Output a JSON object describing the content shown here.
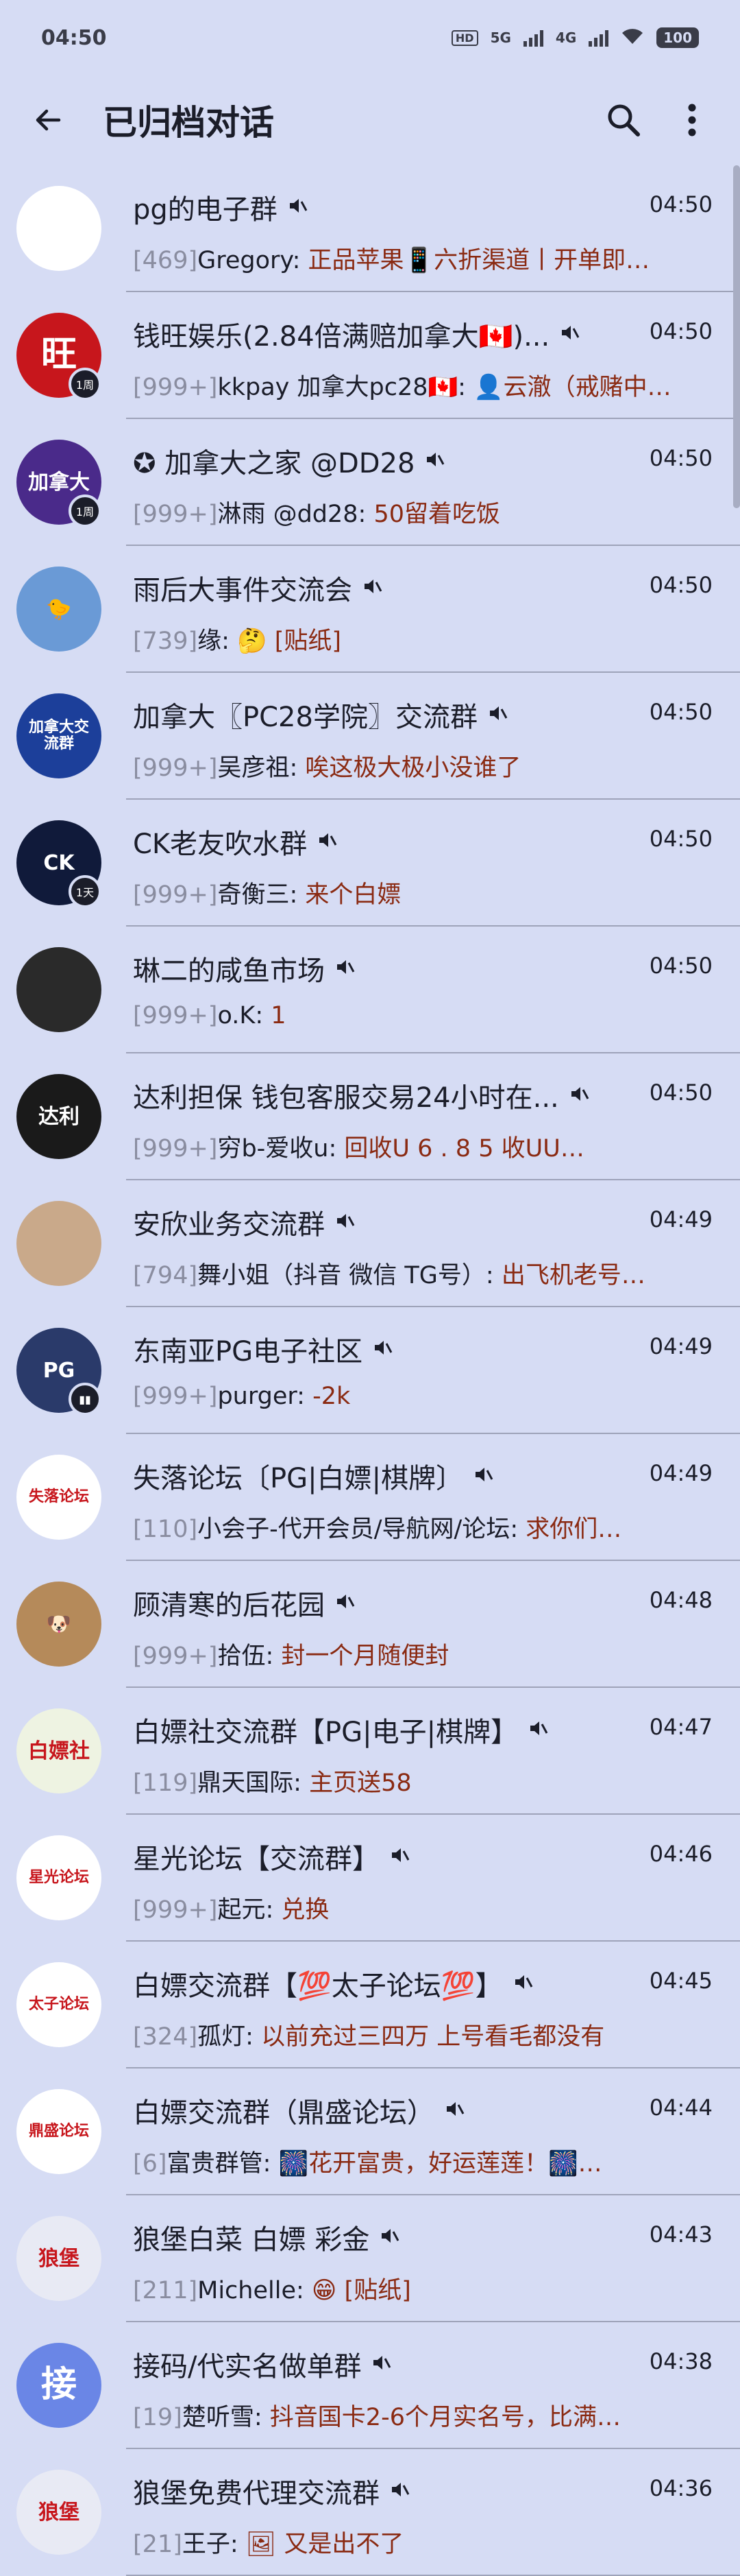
{
  "status_bar": {
    "time": "04:50",
    "network1": "5G",
    "network2": "4G",
    "battery": "100",
    "hd": "HD"
  },
  "app_bar": {
    "title": "已归档对话",
    "back_icon": "arrow-back-icon",
    "search_icon": "search-icon",
    "more_icon": "more-vert-icon"
  },
  "chats": [
    {
      "name": "pg的电子群",
      "time": "04:50",
      "count": "[469]",
      "sender": "Gregory:",
      "text": "正品苹果📱六折渠道丨开单即…",
      "avatar_text": "",
      "avatar_color": "#ffffff",
      "badge": ""
    },
    {
      "name": "钱旺娱乐(2.84倍满赔加拿大🇨🇦)...",
      "time": "04:50",
      "count": "[999+]",
      "sender": "kkpay 加拿大pc28🇨🇦:",
      "text": "👤云澈（戒赌中…",
      "avatar_text": "旺",
      "avatar_color": "#c7161c",
      "badge": "1周"
    },
    {
      "name": "✪ 加拿大之家 @DD28",
      "time": "04:50",
      "count": "[999+]",
      "sender": "淋雨 @dd28:",
      "text": "50留着吃饭",
      "avatar_text": "加拿大",
      "avatar_color": "#4a2a8a",
      "badge": "1周"
    },
    {
      "name": "雨后大事件交流会",
      "time": "04:50",
      "count": "[739]",
      "sender": "缘:",
      "text": "🤔 [贴纸]",
      "avatar_text": "🐤",
      "avatar_color": "#6a9ad6",
      "badge": ""
    },
    {
      "name": "加拿大〖PC28学院〗交流群",
      "time": "04:50",
      "count": "[999+]",
      "sender": "吴彦祖:",
      "text": "唉这极大极小没谁了",
      "avatar_text": "加拿大交流群",
      "avatar_color": "#1c3f9a",
      "badge": ""
    },
    {
      "name": "CK老友吹水群",
      "time": "04:50",
      "count": "[999+]",
      "sender": "奇衡三:",
      "text": "来个白嫖",
      "avatar_text": "CK",
      "avatar_color": "#101a3a",
      "badge": "1天"
    },
    {
      "name": "琳二的咸鱼市场",
      "time": "04:50",
      "count": "[999+]",
      "sender": "o.K:",
      "text": "1",
      "avatar_text": "",
      "avatar_color": "#2a2a2a",
      "badge": ""
    },
    {
      "name": "达利担保 钱包客服交易24小时在...",
      "time": "04:50",
      "count": "[999+]",
      "sender": "穷b-爱收u:",
      "text": "回收U 6 . 8 5 收UU…",
      "avatar_text": "达利",
      "avatar_color": "#1a1a1a",
      "badge": ""
    },
    {
      "name": "安欣业务交流群",
      "time": "04:49",
      "count": "[794]",
      "sender": "舞小姐（抖音 微信 TG号）:",
      "text": "出飞机老号…",
      "avatar_text": "",
      "avatar_color": "#c9a98a",
      "badge": ""
    },
    {
      "name": "东南亚PG电子社区",
      "time": "04:49",
      "count": "[999+]",
      "sender": "purger:",
      "text": "-2k",
      "avatar_text": "PG",
      "avatar_color": "#2a3a6a",
      "badge": "▮▮"
    },
    {
      "name": "失落论坛〔PG|白嫖|棋牌〕",
      "time": "04:49",
      "count": "[110]",
      "sender": "小会子-代开会员/导航网/论坛:",
      "text": "求你们…",
      "avatar_text": "失落论坛",
      "avatar_color": "#ffffff",
      "badge": ""
    },
    {
      "name": "顾清寒的后花园",
      "time": "04:48",
      "count": "[999+]",
      "sender": "拾伍:",
      "text": "封一个月随便封",
      "avatar_text": "🐶",
      "avatar_color": "#b58a5a",
      "badge": ""
    },
    {
      "name": "白嫖社交流群【PG|电子|棋牌】",
      "time": "04:47",
      "count": "[119]",
      "sender": "鼎天国际:",
      "text": "主页送58",
      "avatar_text": "白嫖社",
      "avatar_color": "#eef3e2",
      "badge": ""
    },
    {
      "name": "星光论坛【交流群】",
      "time": "04:46",
      "count": "[999+]",
      "sender": "起元:",
      "text": "兑换",
      "avatar_text": "星光论坛",
      "avatar_color": "#ffffff",
      "badge": ""
    },
    {
      "name": "白嫖交流群【💯太子论坛💯】",
      "time": "04:45",
      "count": "[324]",
      "sender": "孤灯:",
      "text": "以前充过三四万 上号看毛都没有",
      "avatar_text": "太子论坛",
      "avatar_color": "#ffffff",
      "badge": ""
    },
    {
      "name": "白嫖交流群（鼎盛论坛）",
      "time": "04:44",
      "count": "[6]",
      "sender": "富贵群管:",
      "text": "🎆花开富贵，好运莲莲！🎆…",
      "avatar_text": "鼎盛论坛",
      "avatar_color": "#ffffff",
      "badge": ""
    },
    {
      "name": "狼堡白菜 白嫖 彩金",
      "time": "04:43",
      "count": "[211]",
      "sender": "Michelle:",
      "text": "😁 [贴纸]",
      "avatar_text": "狼堡",
      "avatar_color": "#e8eaf4",
      "badge": ""
    },
    {
      "name": "接码/代实名做单群",
      "time": "04:38",
      "count": "[19]",
      "sender": "楚听雪:",
      "text": "抖音国卡2-6个月实名号，比满…",
      "avatar_text": "接",
      "avatar_color": "#6a86e6",
      "badge": ""
    },
    {
      "name": "狼堡免费代理交流群",
      "time": "04:36",
      "count": "[21]",
      "sender": "王子:",
      "text": "🖼 又是出不了",
      "avatar_text": "狼堡",
      "avatar_color": "#e8eaf4",
      "badge": ""
    }
  ]
}
